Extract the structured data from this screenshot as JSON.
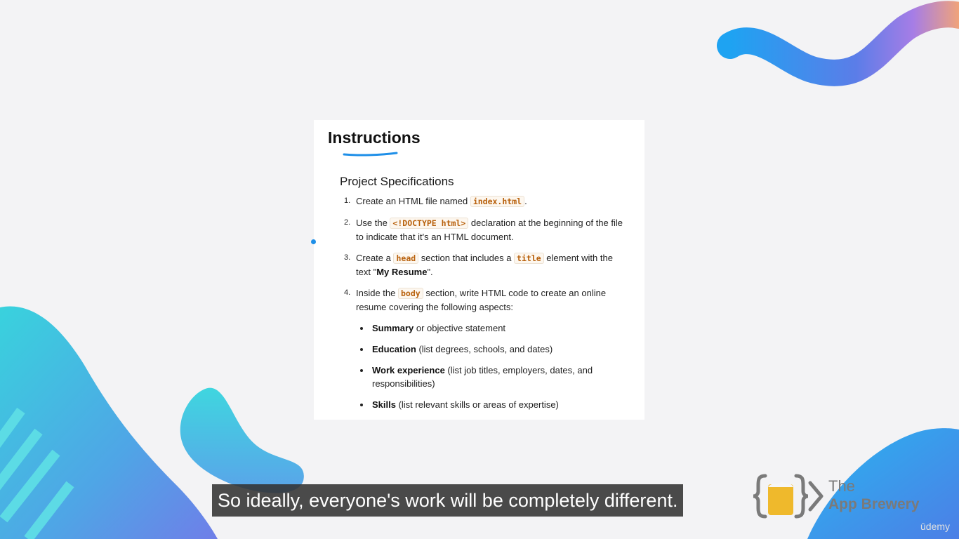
{
  "slide": {
    "heading": "Instructions",
    "subheading": "Project Specifications",
    "steps": [
      {
        "number": "1.",
        "before": "Create an HTML file named ",
        "code": "index.html",
        "after": "."
      },
      {
        "number": "2.",
        "before": "Use the ",
        "code": "<!DOCTYPE html>",
        "after": " declaration at the beginning of the file to indicate that it's an HTML document."
      },
      {
        "number": "3.",
        "before": "Create a ",
        "code": "head",
        "middle": " section that includes a ",
        "code2": "title",
        "middle2": " element with the text \"",
        "bold": "My Resume",
        "after": "\"."
      },
      {
        "number": "4.",
        "before": "Inside the ",
        "code": "body",
        "after": " section, write HTML code to create an online resume covering the following aspects:",
        "aspects": [
          {
            "bold": "Summary",
            "text": " or objective statement"
          },
          {
            "bold": "Education",
            "text": " (list degrees, schools, and dates)"
          },
          {
            "bold": "Work experience",
            "text": " (list job titles, employers, dates, and responsibilities)"
          },
          {
            "bold": "Skills",
            "text": " (list relevant skills or areas of expertise)"
          }
        ]
      }
    ]
  },
  "caption": "So ideally, everyone's work will be completely different.",
  "brand": {
    "line1": "The",
    "line2": "App Brewery",
    "logo_icon": "beer-mug-braces-logo"
  },
  "watermark": "ūdemy",
  "colors": {
    "code_text": "#b8600b",
    "accent_blue": "#1e8fe8",
    "background": "#f3f3f5"
  }
}
